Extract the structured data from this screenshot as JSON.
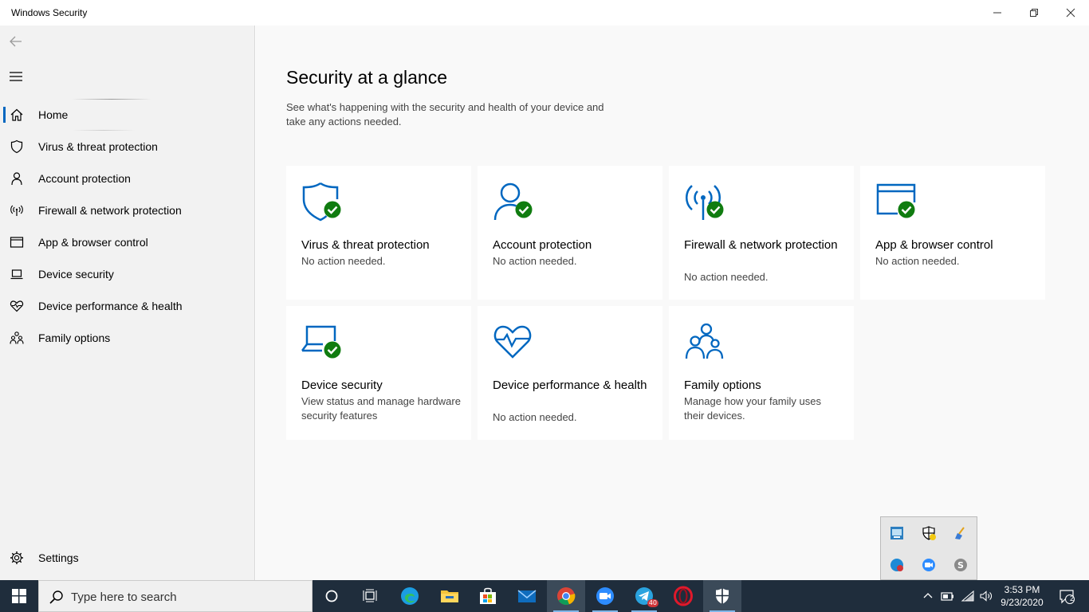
{
  "window": {
    "title": "Windows Security"
  },
  "sidebar": {
    "items": [
      {
        "label": "Home",
        "icon": "home-icon"
      },
      {
        "label": "Virus & threat protection",
        "icon": "shield-icon"
      },
      {
        "label": "Account protection",
        "icon": "person-icon"
      },
      {
        "label": "Firewall & network protection",
        "icon": "antenna-icon"
      },
      {
        "label": "App & browser control",
        "icon": "browser-window-icon"
      },
      {
        "label": "Device security",
        "icon": "laptop-icon"
      },
      {
        "label": "Device performance & health",
        "icon": "heart-pulse-icon"
      },
      {
        "label": "Family options",
        "icon": "family-icon"
      }
    ],
    "settings_label": "Settings"
  },
  "main": {
    "title": "Security at a glance",
    "subtitle": "See what's happening with the security and health of your device and take any actions needed.",
    "cards": [
      {
        "title": "Virus & threat protection",
        "status": "No action needed.",
        "icon": "shield-check-icon"
      },
      {
        "title": "Account protection",
        "status": "No action needed.",
        "icon": "person-check-icon"
      },
      {
        "title": "Firewall & network protection",
        "status": "No action needed.",
        "icon": "antenna-check-icon"
      },
      {
        "title": "App & browser control",
        "status": "No action needed.",
        "icon": "browser-check-icon"
      },
      {
        "title": "Device security",
        "status": "View status and manage hardware security features",
        "icon": "laptop-check-icon"
      },
      {
        "title": "Device performance & health",
        "status": "No action needed.",
        "icon": "heart-pulse-icon"
      },
      {
        "title": "Family options",
        "status": "Manage how your family uses their devices.",
        "icon": "family-icon"
      }
    ]
  },
  "taskbar": {
    "search_placeholder": "Type here to search",
    "telegram_badge": "40",
    "clock_time": "3:53 PM",
    "clock_date": "9/23/2020",
    "notifications_count": "2"
  },
  "colors": {
    "accent": "#0067c0",
    "check_green": "#107c10",
    "taskbar": "#1f2d3c"
  }
}
